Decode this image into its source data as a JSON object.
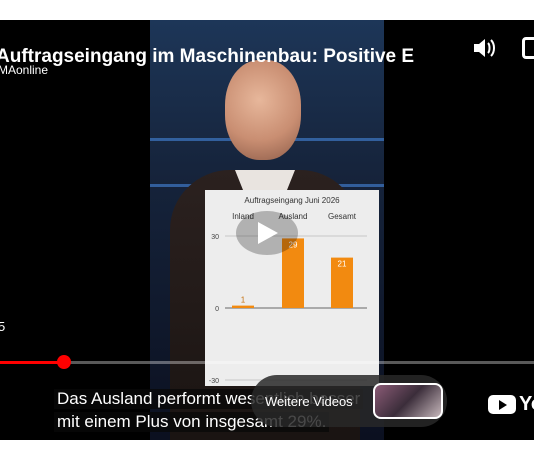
{
  "player": {
    "title": "Auftragseingang im Maschinenbau: Positive E",
    "channel": "MAonline",
    "current_time_fragment": "5",
    "progress_fraction": 0.12,
    "subtitles": {
      "line1": "Das Ausland performt wesentlich besser",
      "line2": "mit einem Plus von insgesamt 29%."
    },
    "more_videos_label": "Weitere Videos",
    "youtube_logo": "You",
    "colors": {
      "accent": "#ff0000",
      "chart_bar": "#f28a10"
    }
  },
  "chart_data": {
    "type": "bar",
    "title": "Auftragseingang Juni 2026",
    "categories": [
      "Inland",
      "Ausland",
      "Gesamt"
    ],
    "values": [
      1,
      29,
      21
    ],
    "yticks": [
      30,
      0,
      -30
    ],
    "ylim": [
      -30,
      30
    ]
  }
}
